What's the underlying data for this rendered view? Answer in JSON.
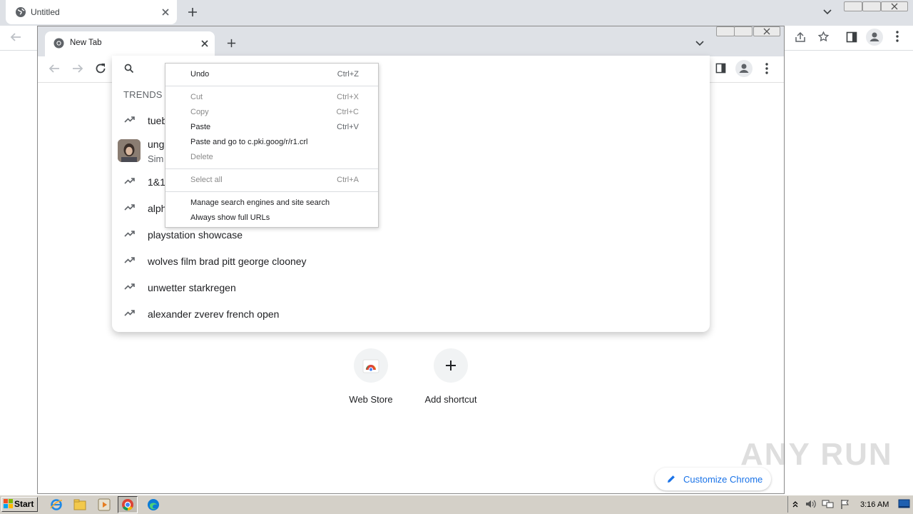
{
  "background_window": {
    "tab_title": "Untitled"
  },
  "foreground_window": {
    "tab_title": "New Tab"
  },
  "omnibox": {
    "trends_heading": "TRENDS E",
    "suggestions": [
      {
        "text": "tueb",
        "subtext": "",
        "icon": "trending-icon"
      },
      {
        "text": "ung",
        "subtext": "Sim",
        "icon": "avatar-thumbnail"
      },
      {
        "text": "1&1",
        "subtext": "",
        "icon": "trending-icon"
      },
      {
        "text": "alph",
        "subtext": "",
        "icon": "trending-icon"
      },
      {
        "text": "playstation showcase",
        "subtext": "",
        "icon": "trending-icon"
      },
      {
        "text": "wolves film brad pitt george clooney",
        "subtext": "",
        "icon": "trending-icon"
      },
      {
        "text": "unwetter starkregen",
        "subtext": "",
        "icon": "trending-icon"
      },
      {
        "text": "alexander zverev french open",
        "subtext": "",
        "icon": "trending-icon"
      }
    ]
  },
  "context_menu": {
    "items": [
      {
        "label": "Undo",
        "shortcut": "Ctrl+Z",
        "disabled": false
      },
      {
        "label": "Cut",
        "shortcut": "Ctrl+X",
        "disabled": true
      },
      {
        "label": "Copy",
        "shortcut": "Ctrl+C",
        "disabled": true
      },
      {
        "label": "Paste",
        "shortcut": "Ctrl+V",
        "disabled": false
      },
      {
        "label": "Paste and go to c.pki.goog/r/r1.crl",
        "shortcut": "",
        "disabled": false
      },
      {
        "label": "Delete",
        "shortcut": "",
        "disabled": true
      },
      {
        "label": "Select all",
        "shortcut": "Ctrl+A",
        "disabled": true
      },
      {
        "label": "Manage search engines and site search",
        "shortcut": "",
        "disabled": false
      },
      {
        "label": "Always show full URLs",
        "shortcut": "",
        "disabled": false
      }
    ]
  },
  "shortcuts": [
    {
      "label": "Web Store",
      "icon": "web-store-icon"
    },
    {
      "label": "Add shortcut",
      "icon": "plus-icon"
    }
  ],
  "customize_chrome": {
    "label": "Customize Chrome",
    "icon": "pencil-icon"
  },
  "watermark": "ANY RUN",
  "taskbar": {
    "start_label": "Start",
    "clock": "3:16 AM"
  },
  "colors": {
    "accent": "#1a73e8",
    "tabstrip": "#dee1e6",
    "taskbar": "#d4d0c8"
  }
}
